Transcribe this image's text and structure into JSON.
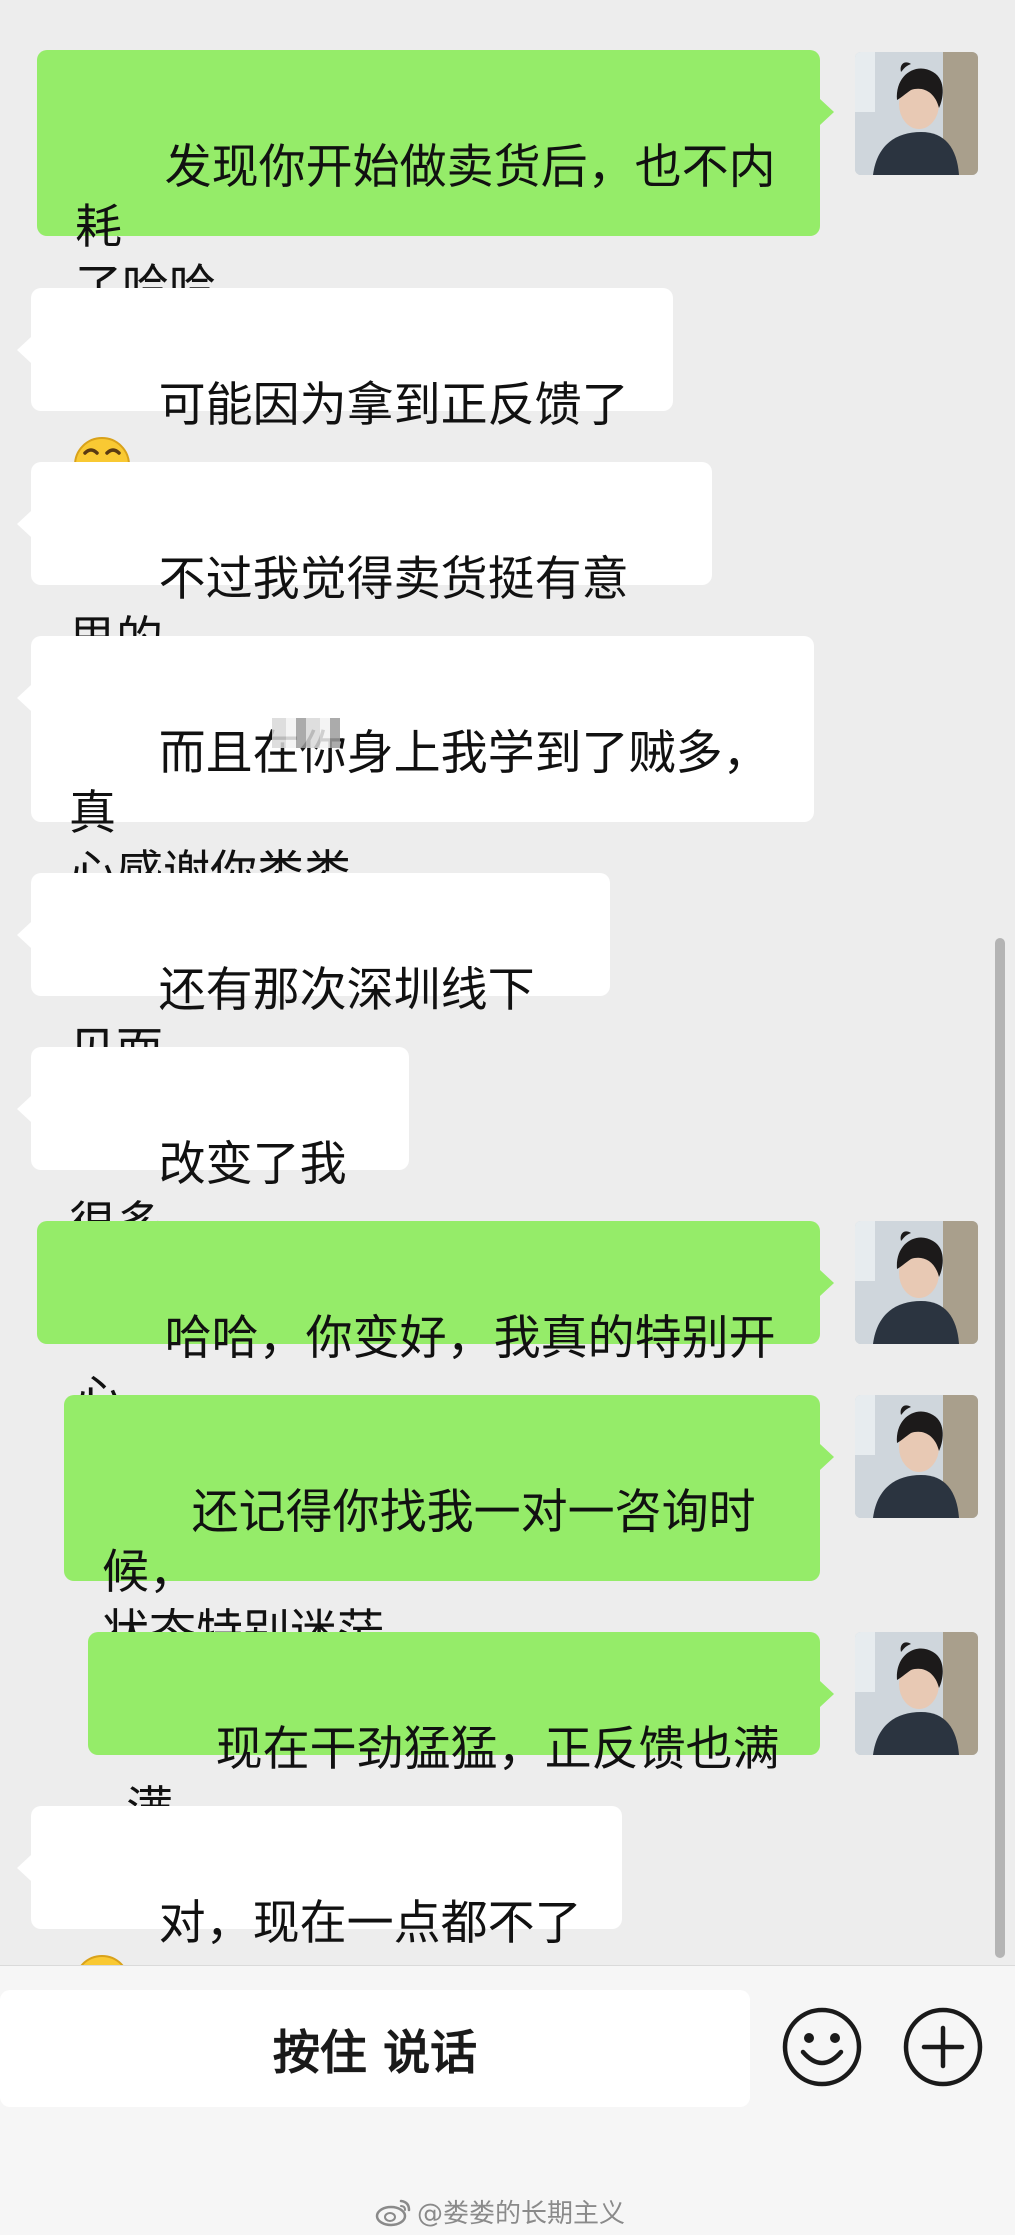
{
  "messages": [
    {
      "side": "sent",
      "text": "发现你开始做卖货后，也不内耗\n了哈哈"
    },
    {
      "side": "recv",
      "text": "可能因为拿到正反馈了",
      "emoji": "grinning-face-emoji"
    },
    {
      "side": "recv",
      "text": "不过我觉得卖货挺有意思的"
    },
    {
      "side": "recv",
      "text": "而且在你身上我学到了贼多，真\n心感谢你娄娄"
    },
    {
      "side": "recv",
      "text": "还有那次深圳线下见面"
    },
    {
      "side": "recv",
      "text": "改变了我很多"
    },
    {
      "side": "sent",
      "text": "哈哈，你变好，我真的特别开心"
    },
    {
      "side": "sent",
      "text": "还记得你找我一对一咨询时候，\n状态特别迷茫"
    },
    {
      "side": "sent",
      "text": "现在干劲猛猛，正反馈也满满"
    },
    {
      "side": "recv",
      "text": "对，现在一点都不了",
      "emoji": "thinking-face-emoji"
    }
  ],
  "input_bar": {
    "hold_to_talk_label": "按住 说话",
    "emoji_button_icon": "smiley-face-icon",
    "more_button_icon": "plus-circle-icon"
  },
  "watermark": {
    "text": "@娄娄的长期主义",
    "icon": "weibo-icon"
  },
  "colors": {
    "background": "#ededed",
    "sent_bubble": "#95ec69",
    "received_bubble": "#ffffff"
  }
}
